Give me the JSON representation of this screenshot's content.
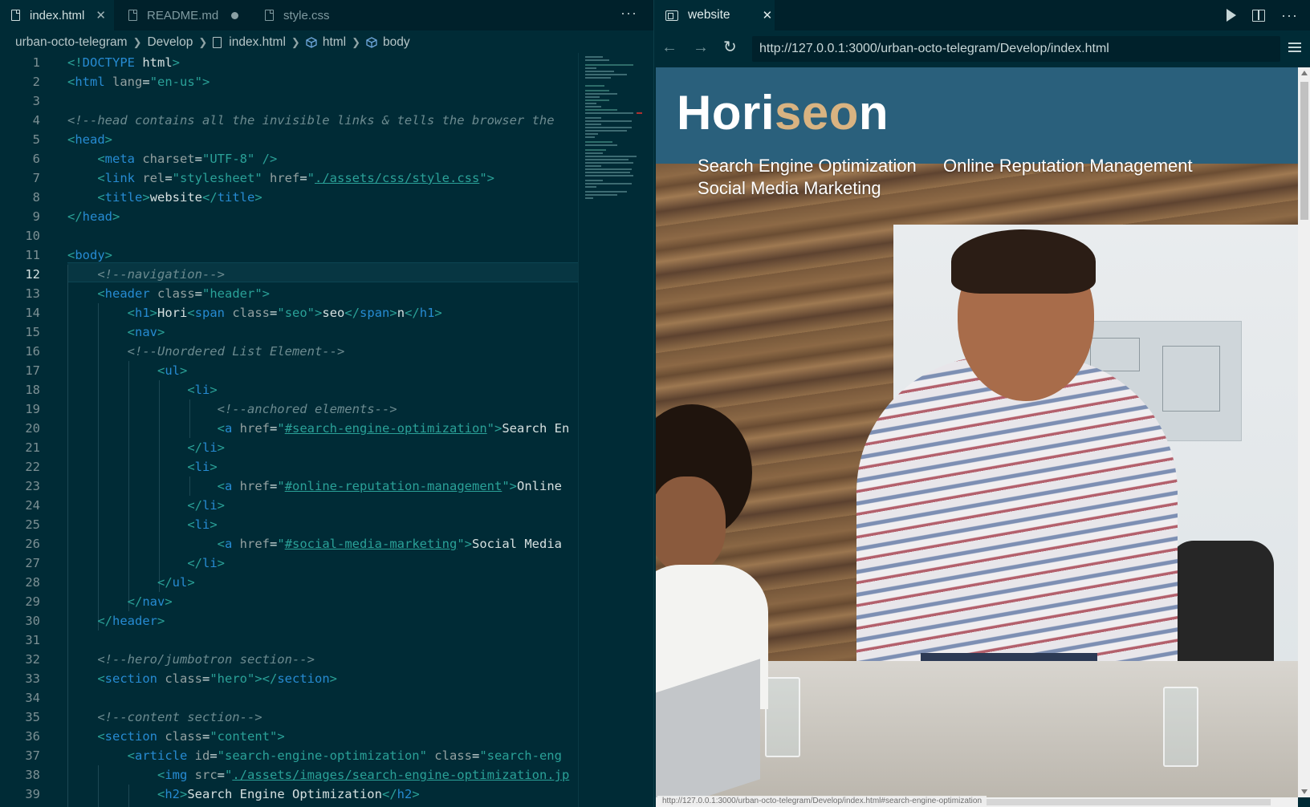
{
  "editor": {
    "tabs": [
      {
        "label": "index.html",
        "active": true,
        "state": "close"
      },
      {
        "label": "README.md",
        "active": false,
        "state": "modified"
      },
      {
        "label": "style.css",
        "active": false,
        "state": "none"
      }
    ],
    "more": "···",
    "breadcrumb": [
      "urban-octo-telegram",
      "Develop",
      "index.html",
      "html",
      "body"
    ],
    "current_line": 12
  },
  "browser": {
    "tab_label": "website",
    "more": "···",
    "url": "http://127.0.0.1:3000/urban-octo-telegram/Develop/index.html",
    "status_url": "http://127.0.0.1:3000/urban-octo-telegram/Develop/index.html#search-engine-optimization",
    "site": {
      "title_a": "Hori",
      "title_b": "seo",
      "title_c": "n",
      "nav": [
        "Search Engine Optimization",
        "Online Reputation Management",
        "Social Media Marketing"
      ]
    }
  },
  "colors": {
    "editor_bg": "#002b36",
    "tabbar_bg": "#00212b",
    "site_header": "#2a607c",
    "accent_seo": "#d9b381"
  },
  "icons": [
    "file-icon",
    "close-icon",
    "modified-dot-icon",
    "more-icon",
    "chevron-right-icon",
    "symbol-cube-icon",
    "preview-icon",
    "play-icon",
    "split-editor-icon",
    "back-icon",
    "forward-icon",
    "reload-icon",
    "menu-icon"
  ]
}
